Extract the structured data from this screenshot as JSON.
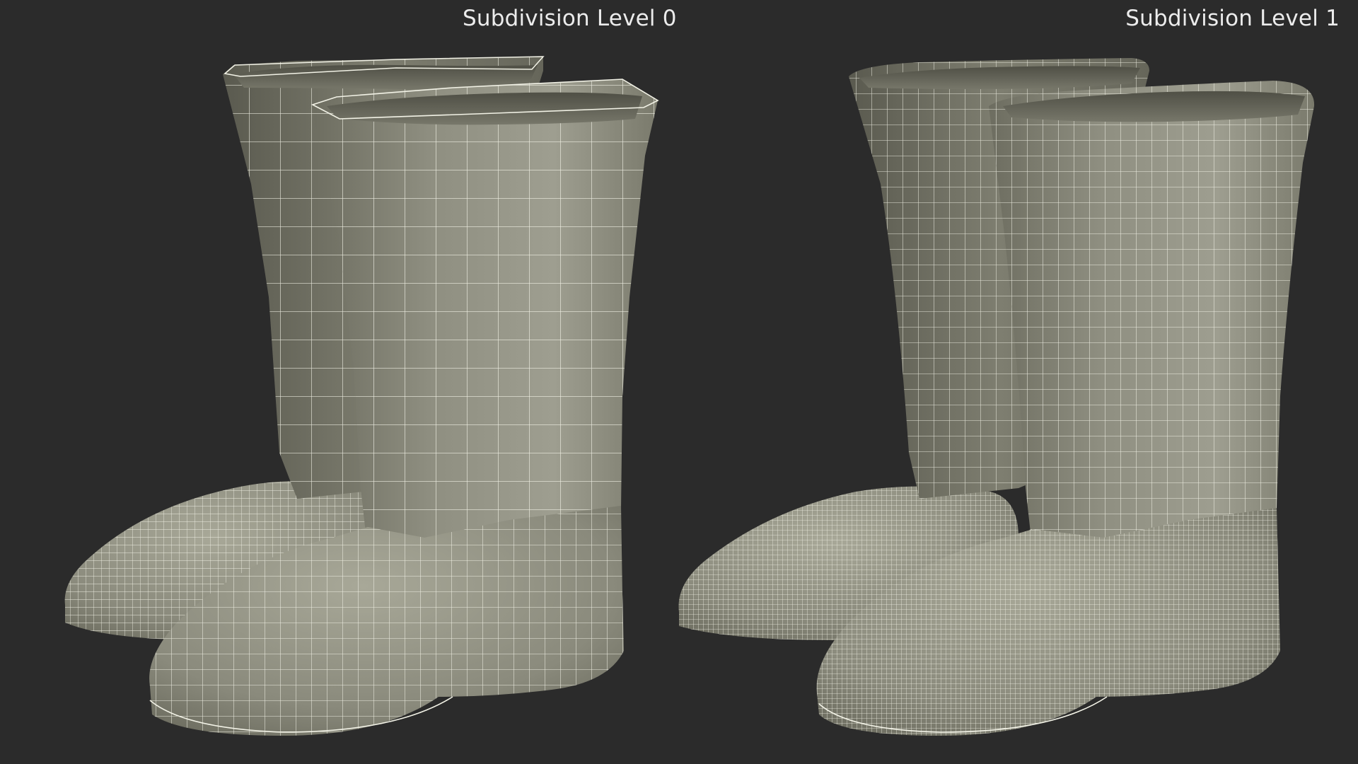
{
  "panels": [
    {
      "title": "Subdivision Level 0"
    },
    {
      "title": "Subdivision Level 1"
    }
  ],
  "colors": {
    "background": "#2b2b2b",
    "shell_light": "#9c9c8d",
    "shell_dark": "#5e5e53",
    "wire": "#f2f2e6",
    "label": "#ececec"
  }
}
